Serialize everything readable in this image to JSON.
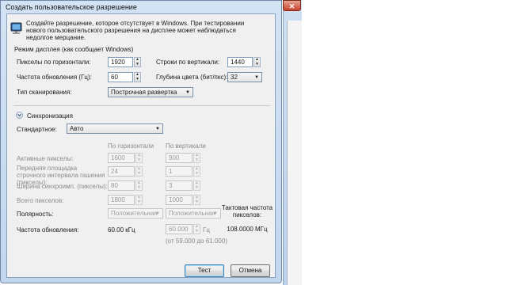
{
  "window": {
    "title": "Создать пользовательское разрешение",
    "close_glyph": "✕"
  },
  "intro": "Создайте разрешение, которое отсутствует в Windows. При тестировании нового пользовательского разрешения на дисплее может наблюдаться недолгое мерцание.",
  "display_mode": {
    "section_label": "Режим дисплея (как сообщает Windows)",
    "h_pixels_label": "Пикселы по горизонтали:",
    "h_pixels_value": "1920",
    "v_lines_label": "Строки по вертикали:",
    "v_lines_value": "1440",
    "refresh_label": "Частота обновления (Гц):",
    "refresh_value": "60",
    "color_depth_label": "Глубина цвета (бит/пкс):",
    "color_depth_value": "32",
    "scan_type_label": "Тип сканирования:",
    "scan_type_value": "Построчная развертка"
  },
  "timing": {
    "section_label": "Синхронизация",
    "standard_label": "Стандартное:",
    "standard_value": "Авто",
    "col_horizontal": "По горизонтали",
    "col_vertical": "По вертикали",
    "active_pixels_label": "Активные пикселы:",
    "active_h": "1600",
    "active_v": "900",
    "front_porch_label": "Передняя площадка строчного интервала гашения (пикселы):",
    "front_porch_h": "24",
    "front_porch_v": "1",
    "sync_width_label": "Ширина синхроимп. (пикселы):",
    "sync_width_h": "80",
    "sync_width_v": "3",
    "total_pixels_label": "Всего пикселов:",
    "total_h": "1800",
    "total_v": "1000",
    "polarity_label": "Полярность:",
    "polarity_h": "Положительная",
    "polarity_v": "Положительная",
    "refresh_rate_label": "Частота обновления:",
    "refresh_khz": "60.00 кГц",
    "refresh_hz_value": "60.000",
    "refresh_unit": "Гц",
    "refresh_range": "(от 59.000 до 61.000)",
    "pixel_clock_label": "Тактовая частота пикселов:",
    "pixel_clock_value": "108.0000 МГц"
  },
  "buttons": {
    "test": "Тест",
    "cancel": "Отмена"
  },
  "icons": [
    "monitor-icon",
    "expander-chevron-icon",
    "spin-up-icon",
    "spin-down-icon",
    "dropdown-arrow-icon",
    "close-icon"
  ]
}
